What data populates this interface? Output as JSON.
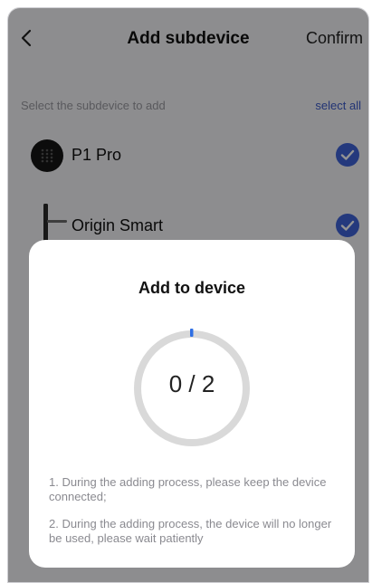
{
  "header": {
    "title": "Add subdevice",
    "confirm_label": "Confirm"
  },
  "list": {
    "prompt": "Select the subdevice to add",
    "select_all_label": "select all",
    "items": [
      {
        "name": "P1 Pro",
        "checked": true
      },
      {
        "name": "Origin Smart",
        "checked": true
      }
    ]
  },
  "modal": {
    "title": "Add to device",
    "progress": {
      "done": 0,
      "total": 2,
      "text": "0 / 2"
    },
    "notes": [
      "1. During the adding process, please keep the device connected;",
      "2. During the adding process, the device will no longer be used, please wait patiently"
    ]
  },
  "colors": {
    "accent": "#3f63d8",
    "link": "#3b5bc9",
    "ring_track": "#d9d9d9",
    "ring_fill": "#2f6fe4"
  }
}
